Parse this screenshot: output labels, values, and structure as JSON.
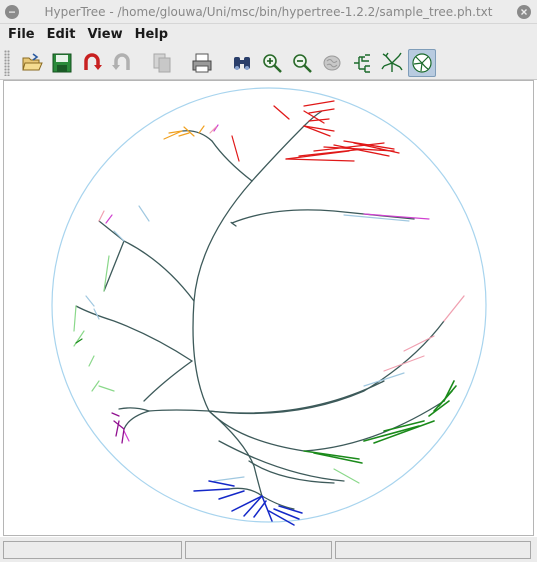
{
  "window": {
    "title": "HyperTree - /home/glouwa/Uni/msc/bin/hypertree-1.2.2/sample_tree.ph.txt"
  },
  "menu": {
    "items": [
      {
        "label": "File"
      },
      {
        "label": "Edit"
      },
      {
        "label": "View"
      },
      {
        "label": "Help"
      }
    ]
  },
  "toolbar": {
    "buttons": [
      {
        "icon": "open-folder-icon",
        "enabled": true
      },
      {
        "icon": "save-icon",
        "enabled": true
      },
      {
        "icon": "undo-icon",
        "enabled": true
      },
      {
        "icon": "redo-icon",
        "enabled": false
      },
      {
        "icon": "copy-icon",
        "enabled": false
      },
      {
        "icon": "print-icon",
        "enabled": true
      },
      {
        "icon": "find-binoculars-icon",
        "enabled": true
      },
      {
        "icon": "zoom-in-icon",
        "enabled": true
      },
      {
        "icon": "zoom-out-icon",
        "enabled": true
      },
      {
        "icon": "brain-icon",
        "enabled": false
      },
      {
        "icon": "rectangular-tree-icon",
        "enabled": true
      },
      {
        "icon": "radial-tree-icon",
        "enabled": true
      },
      {
        "icon": "hyperbolic-tree-icon",
        "enabled": true,
        "active": true
      }
    ]
  },
  "tree_view": {
    "boundary_color": "#a8d4ee",
    "trunk_color": "#3d5a5a",
    "clade_colors": {
      "red": "#e01818",
      "pink": "#f0a0b0",
      "magenta": "#d040d0",
      "orange": "#f0a020",
      "blue": "#1428c8",
      "green": "#1a8a1a",
      "light_green": "#8ad88a",
      "light_blue": "#a0c8e0",
      "purple": "#901090"
    }
  },
  "statusbar": {
    "fields": [
      "",
      "",
      ""
    ]
  }
}
